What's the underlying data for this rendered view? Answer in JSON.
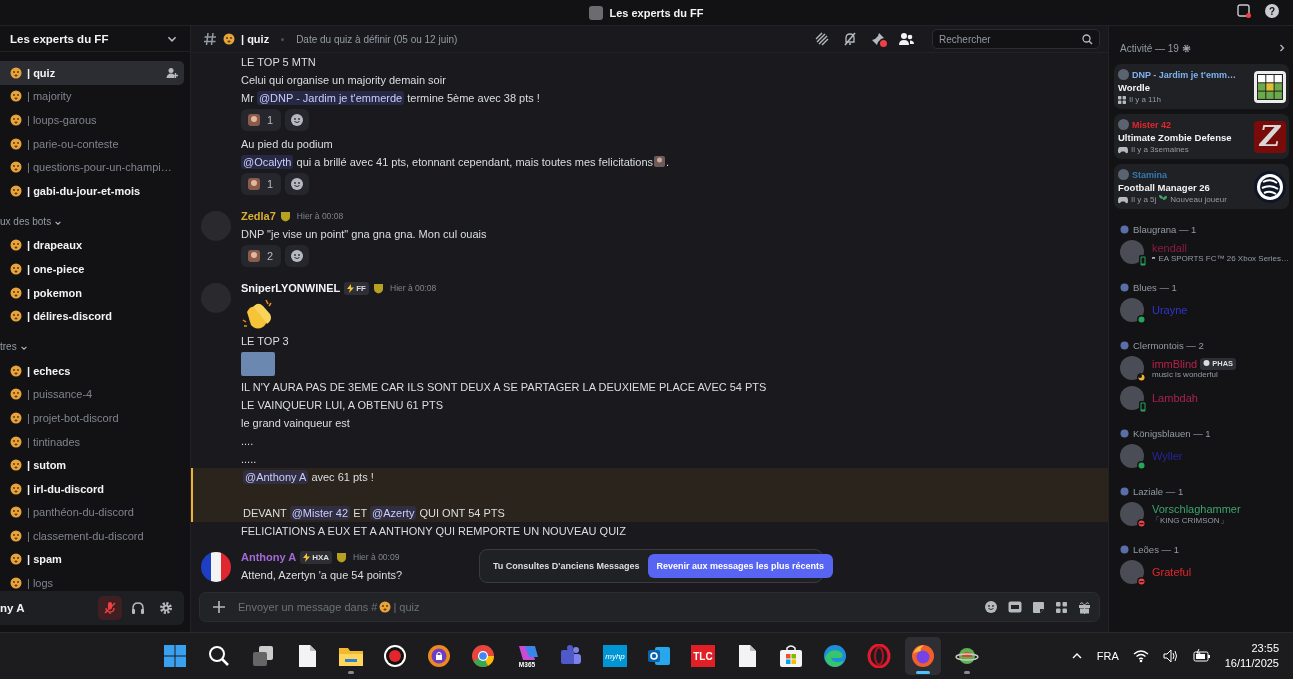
{
  "title_bar": {
    "title": "Les experts du FF",
    "help": "?"
  },
  "sidebar": {
    "server": "Les experts du FF",
    "channels": [
      {
        "name": "| quiz",
        "selected": true,
        "unread": true
      },
      {
        "name": "| majority",
        "selected": false,
        "unread": false
      },
      {
        "name": "| loups-garous",
        "selected": false,
        "unread": false
      },
      {
        "name": "| parie-ou-conteste",
        "selected": false,
        "unread": false
      },
      {
        "name": "| questions-pour-un-champi…",
        "selected": false,
        "unread": false
      },
      {
        "name": "| gabi-du-jour-et-mois",
        "selected": false,
        "unread": true
      }
    ],
    "categories": [
      {
        "name": "ux des bots",
        "expanded": true,
        "channels": [
          {
            "name": "| drapeaux",
            "selected": false,
            "unread": true
          },
          {
            "name": "| one-piece",
            "selected": false,
            "unread": true
          },
          {
            "name": "| pokemon",
            "selected": false,
            "unread": true
          },
          {
            "name": "| délires-discord",
            "selected": false,
            "unread": true
          }
        ]
      },
      {
        "name": "tres",
        "expanded": true,
        "channels": [
          {
            "name": "| echecs",
            "selected": false,
            "unread": true
          },
          {
            "name": "| puissance-4",
            "selected": false,
            "unread": false
          },
          {
            "name": "| projet-bot-discord",
            "selected": false,
            "unread": false
          },
          {
            "name": "| tintinades",
            "selected": false,
            "unread": false
          },
          {
            "name": "| sutom",
            "selected": false,
            "unread": true
          },
          {
            "name": "| irl-du-discord",
            "selected": false,
            "unread": true
          },
          {
            "name": "| panthéon-du-discord",
            "selected": false,
            "unread": false
          },
          {
            "name": "| classement-du-discord",
            "selected": false,
            "unread": false
          },
          {
            "name": "| spam",
            "selected": false,
            "unread": true
          },
          {
            "name": "| logs",
            "selected": false,
            "unread": false
          }
        ]
      }
    ],
    "user_panel": {
      "name": "ny A",
      "mic_muted": true
    }
  },
  "header": {
    "channel": "| quiz",
    "topic": "Date du quiz à définir (05 ou 12 juin)",
    "pins_unread": true,
    "search": {
      "placeholder": "Rechercher"
    }
  },
  "messages": {
    "groups": [
      {
        "items": [
          {
            "kind": "text",
            "parts": [
              {
                "kind": "text",
                "text": "LE TOP 5 MTN"
              }
            ]
          },
          {
            "kind": "text",
            "parts": [
              {
                "kind": "text",
                "text": "Celui qui organise un majority demain soir"
              }
            ]
          },
          {
            "kind": "text",
            "parts": [
              {
                "kind": "text",
                "text": "Mr "
              },
              {
                "kind": "mention",
                "text": "@DNP - Jardim je t'emmerde"
              },
              {
                "kind": "text",
                "text": " termine 5ème avec 38 pts !"
              }
            ]
          },
          {
            "kind": "reaction",
            "count": "1"
          },
          {
            "kind": "text",
            "parts": [
              {
                "kind": "text",
                "text": "Au pied du podium"
              }
            ]
          },
          {
            "kind": "text",
            "parts": [
              {
                "kind": "mention",
                "text": "@Ocalyth"
              },
              {
                "kind": "text",
                "text": " qui a brillé avec 41 pts, etonnant cependant, mais toutes mes felicitations"
              },
              {
                "kind": "emoji"
              },
              {
                "kind": "text",
                "text": "."
              }
            ]
          },
          {
            "kind": "reaction",
            "count": "1"
          }
        ]
      },
      {
        "author": {
          "name": "Zedla7",
          "color": "#d9b02e",
          "avatar": {
            "kind": "photo"
          },
          "time": "Hier à 00:08"
        },
        "items": [
          {
            "kind": "text",
            "parts": [
              {
                "kind": "text",
                "text": "DNP \"je vise un point\" gna gna gna. Mon cul ouais"
              }
            ]
          },
          {
            "kind": "reaction",
            "count": "2"
          }
        ]
      },
      {
        "author": {
          "name": "SniperLYONWINEL",
          "color": "#f2f3f5",
          "avatar": {
            "kind": "photo"
          },
          "tag": "FF",
          "time": "Hier à 00:08"
        },
        "items": [
          {
            "kind": "big_emoji"
          },
          {
            "kind": "text",
            "parts": [
              {
                "kind": "text",
                "text": "LE TOP 3"
              }
            ]
          },
          {
            "kind": "image"
          },
          {
            "kind": "text",
            "parts": [
              {
                "kind": "text",
                "text": "IL N'Y AURA PAS DE 3EME CAR ILS SONT DEUX A SE PARTAGER LA DEUXIEME PLACE AVEC 54 PTS"
              }
            ]
          },
          {
            "kind": "text",
            "parts": [
              {
                "kind": "text",
                "text": "LE VAINQUEUR LUI, A OBTENU 61 PTS"
              }
            ]
          },
          {
            "kind": "text",
            "parts": [
              {
                "kind": "text",
                "text": "le grand vainqueur est"
              }
            ]
          },
          {
            "kind": "text",
            "parts": [
              {
                "kind": "text",
                "text": "...."
              }
            ]
          },
          {
            "kind": "text",
            "parts": [
              {
                "kind": "text",
                "text": "....."
              }
            ]
          },
          {
            "kind": "mention_block",
            "lines": [
              {
                "parts": [
                  {
                    "kind": "mention",
                    "text": "@Anthony A"
                  },
                  {
                    "kind": "text",
                    "text": " avec 61 pts !"
                  }
                ]
              },
              {
                "parts": [
                  {
                    "kind": "text",
                    "text": "DEVANT "
                  },
                  {
                    "kind": "mention",
                    "text": "@Mister 42"
                  },
                  {
                    "kind": "text",
                    "text": " ET "
                  },
                  {
                    "kind": "mention",
                    "text": "@Azerty"
                  },
                  {
                    "kind": "text",
                    "text": " QUI ONT 54 PTS"
                  }
                ]
              }
            ]
          },
          {
            "kind": "text",
            "parts": [
              {
                "kind": "text",
                "text": "FELICIATIONS A EUX ET A ANTHONY QUI REMPORTE UN NOUVEAU QUIZ"
              }
            ]
          }
        ]
      },
      {
        "author": {
          "name": "Anthony A",
          "color": "#a36ad6",
          "avatar": {
            "kind": "flag"
          },
          "tag": "HXA",
          "time": "Hier à 00:09"
        },
        "items": [
          {
            "kind": "text",
            "parts": [
              {
                "kind": "text",
                "text": "Attend, Azertyn 'a que 54 points?"
              }
            ]
          }
        ]
      }
    ],
    "banner": {
      "text": "Tu Consultes D'anciens Messages",
      "button": "Revenir aux messages les plus récents"
    }
  },
  "composer": {
    "placeholder": "Envoyer un message dans #",
    "channel": "| quiz"
  },
  "members": {
    "activity": {
      "title": "Activité — 19",
      "cards": [
        {
          "user": "DNP - Jardim je t'emm…",
          "color": "#7fb2f0",
          "game": "Wordle",
          "meta": {
            "kind": "apps",
            "time": "Il y a 11h"
          },
          "thumb": {
            "kind": "grid"
          }
        },
        {
          "user": "Mister 42",
          "color": "#e3262b",
          "game": "Ultimate Zombie Defense",
          "meta": {
            "kind": "gamepad",
            "time": "Il y a 3semaines"
          },
          "thumb": {
            "kind": "letter",
            "text": "Z"
          }
        },
        {
          "user": "Stamina",
          "color": "#3579b5",
          "game": "Football Manager 26",
          "meta": {
            "kind": "gamepad",
            "time": "Il y a 5j",
            "note": "Nouveau joueur"
          },
          "thumb": {
            "kind": "ball"
          }
        }
      ]
    },
    "groups": [
      {
        "role": "Blaugrana — 1",
        "members": [
          {
            "name": "kendall",
            "color": "#8c1c3e",
            "presence": {
              "kind": "mobile"
            },
            "game": "EA SPORTS FC™ 26 Xbox Series…"
          }
        ]
      },
      {
        "role": "Blues — 1",
        "members": [
          {
            "name": "Urayne",
            "color": "#2c36cc",
            "presence": {
              "kind": "online"
            }
          }
        ]
      },
      {
        "role": "Clermontois — 2",
        "members": [
          {
            "name": "immBlind",
            "color": "#b7214b",
            "presence": {
              "kind": "idle"
            },
            "tag": "PHAS",
            "custom_status": "music is wonderful"
          },
          {
            "name": "Lambdah",
            "color": "#a8224c",
            "presence": {
              "kind": "mobile"
            }
          }
        ]
      },
      {
        "role": "Königsblauen — 1",
        "members": [
          {
            "name": "Wyller",
            "color": "#23279a",
            "presence": {
              "kind": "online"
            }
          }
        ]
      },
      {
        "role": "Laziale — 1",
        "members": [
          {
            "name": "Vorschlaghammer",
            "color": "#3da46c",
            "presence": {
              "kind": "dnd"
            },
            "custom_status": "「KING CRIMSON」"
          }
        ]
      },
      {
        "role": "Leões — 1",
        "members": [
          {
            "name": "Grateful",
            "color": "#e1262c",
            "presence": {
              "kind": "dnd"
            }
          }
        ]
      }
    ]
  },
  "taskbar": {
    "apps": [
      {
        "kind": "start",
        "running": false,
        "active": false
      },
      {
        "kind": "search",
        "running": false,
        "active": false
      },
      {
        "kind": "taskview",
        "running": false,
        "active": false
      },
      {
        "kind": "file",
        "running": false,
        "active": false
      },
      {
        "kind": "explorer",
        "running": true,
        "active": false
      },
      {
        "kind": "record",
        "running": false,
        "active": false
      },
      {
        "kind": "vpn",
        "running": false,
        "active": false
      },
      {
        "kind": "chrome",
        "running": false,
        "active": false
      },
      {
        "kind": "m365",
        "label": "M365",
        "running": false,
        "active": false
      },
      {
        "kind": "teams",
        "running": false,
        "active": false
      },
      {
        "kind": "myhp",
        "label": "myhp",
        "running": false,
        "active": false
      },
      {
        "kind": "outlook",
        "running": false,
        "active": false
      },
      {
        "kind": "tlc",
        "label": "TLC",
        "running": false,
        "active": false
      },
      {
        "kind": "file",
        "running": false,
        "active": false
      },
      {
        "kind": "store",
        "running": false,
        "active": false
      },
      {
        "kind": "edge",
        "running": false,
        "active": false
      },
      {
        "kind": "opera",
        "running": false,
        "active": false
      },
      {
        "kind": "firefox",
        "running": true,
        "active": true
      },
      {
        "kind": "planet",
        "running": true,
        "active": false
      }
    ],
    "language": "FRA",
    "time": "23:55",
    "date": "16/11/2025"
  }
}
